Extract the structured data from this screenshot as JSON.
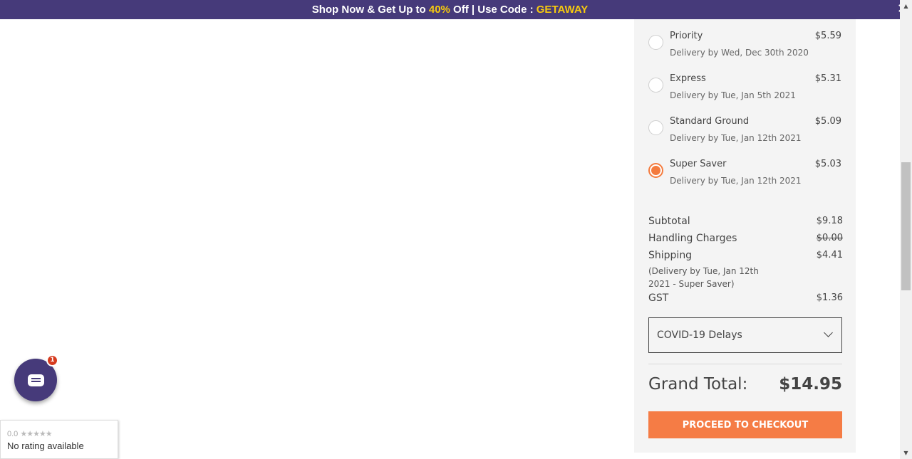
{
  "banner": {
    "text_1": "Shop Now & Get Up to ",
    "highlight_1": "40%",
    "text_2": " Off | Use Code : ",
    "highlight_2": "GETAWAY",
    "close_glyph": "✕"
  },
  "shipping_options": [
    {
      "name": "Priority",
      "delivery": "Delivery by Wed, Dec 30th 2020",
      "price": "$5.59",
      "selected": false
    },
    {
      "name": "Express",
      "delivery": "Delivery by Tue, Jan 5th 2021",
      "price": "$5.31",
      "selected": false
    },
    {
      "name": "Standard Ground",
      "delivery": "Delivery by Tue, Jan 12th 2021",
      "price": "$5.09",
      "selected": false
    },
    {
      "name": "Super Saver",
      "delivery": "Delivery by Tue, Jan 12th 2021",
      "price": "$5.03",
      "selected": true
    }
  ],
  "summary": {
    "subtotal_label": "Subtotal",
    "subtotal_value": "$9.18",
    "handling_label": "Handling Charges",
    "handling_value": "$0.00",
    "shipping_label": "Shipping",
    "shipping_value": "$4.41",
    "shipping_note": "(Delivery by Tue, Jan 12th 2021 - Super Saver)",
    "gst_label": "GST",
    "gst_value": "$1.36"
  },
  "delay_select": {
    "selected": "COVID-19 Delays"
  },
  "grand_total": {
    "label": "Grand Total:",
    "value": "$14.95"
  },
  "checkout_button": "PROCEED TO CHECKOUT",
  "chat": {
    "badge": "1"
  },
  "rating_widget": {
    "score": "0.0",
    "stars": "★★★★★",
    "text": "No rating available"
  },
  "colors": {
    "brand": "#463a7a",
    "accent": "#f57c45",
    "highlight": "#f6c90e"
  }
}
